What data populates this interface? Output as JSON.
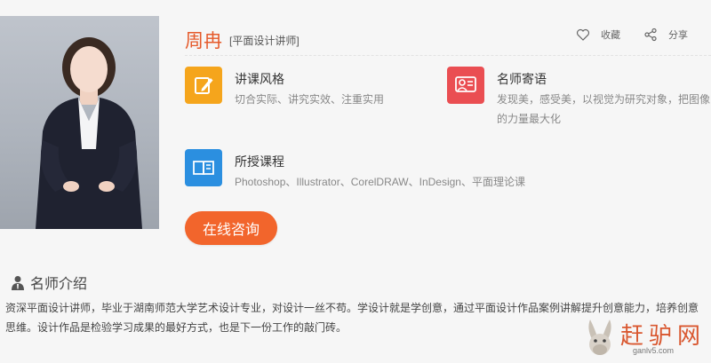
{
  "teacher": {
    "name": "周冉",
    "title": "[平面设计讲师]"
  },
  "actions": {
    "favorite_label": "收藏",
    "share_label": "分享"
  },
  "info": {
    "style": {
      "icon": "edit-icon",
      "title": "讲课风格",
      "text": "切合实际、讲究实效、注重实用"
    },
    "motto": {
      "icon": "teacher-quote-icon",
      "title": "名师寄语",
      "text_line1": "发现美，感受美，以视觉为研究对象，把图像",
      "text_line2": "的力量最大化"
    },
    "courses": {
      "icon": "book-icon",
      "title": "所授课程",
      "text": "Photoshop、Illustrator、CorelDRAW、InDesign、平面理论课"
    }
  },
  "consult_button": "在线咨询",
  "intro": {
    "heading": "名师介绍",
    "text": "资深平面设计讲师，毕业于湖南师范大学艺术设计专业，对设计一丝不苟。学设计就是学创意，通过平面设计作品案例讲解提升创意能力，培养创意思维。设计作品是检验学习成果的最好方式，也是下一份工作的敲门砖。"
  },
  "watermark": {
    "brand": "赶驴网",
    "url": "ganlv5.com"
  },
  "colors": {
    "accent": "#f2652c",
    "name": "#e55a2b",
    "orange_badge": "#f5a51c",
    "red_badge": "#ea4e52",
    "blue_badge": "#2b8fe0"
  }
}
